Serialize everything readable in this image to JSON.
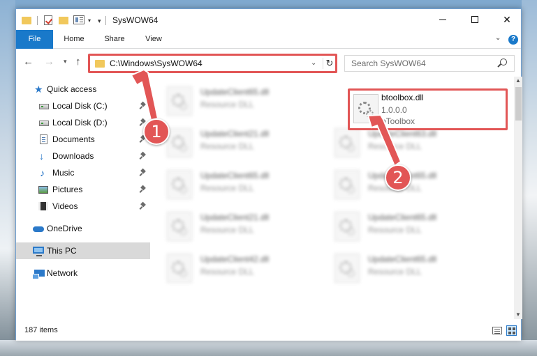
{
  "window": {
    "title": "SysWOW64",
    "minimize_icon": "minimize-icon",
    "maximize_icon": "maximize-icon",
    "close_label": "✕"
  },
  "ribbon": {
    "tabs": [
      "File",
      "Home",
      "Share",
      "View"
    ],
    "help_label": "?"
  },
  "navigation": {
    "address_path": "C:\\Windows\\SysWOW64",
    "search_placeholder": "Search SysWOW64"
  },
  "sidebar": {
    "items": [
      {
        "label": "Quick access",
        "icon": "star-icon"
      },
      {
        "label": "Local Disk (C:)",
        "icon": "drive-icon"
      },
      {
        "label": "Local Disk (D:)",
        "icon": "drive-icon"
      },
      {
        "label": "Documents",
        "icon": "documents-icon"
      },
      {
        "label": "Downloads",
        "icon": "download-icon"
      },
      {
        "label": "Music",
        "icon": "music-icon"
      },
      {
        "label": "Pictures",
        "icon": "pictures-icon"
      },
      {
        "label": "Videos",
        "icon": "videos-icon"
      },
      {
        "label": "OneDrive",
        "icon": "onedrive-icon"
      },
      {
        "label": "This PC",
        "icon": "pc-icon"
      },
      {
        "label": "Network",
        "icon": "network-icon"
      }
    ]
  },
  "files": {
    "left_column": [
      {
        "name": "UpdateClient65.dll",
        "type": "Resource DLL"
      },
      {
        "name": "UpdateClient21.dll",
        "type": "Resource DLL"
      },
      {
        "name": "UpdateClient65.dll",
        "type": "Resource DLL"
      },
      {
        "name": "UpdateClient21.dll",
        "type": "Resource DLL"
      },
      {
        "name": "UpdateClient42.dll",
        "type": "Resource DLL"
      }
    ],
    "highlighted": {
      "name": "btoolbox.dll",
      "version": "1.0.0.0",
      "description": "bToolbox"
    },
    "right_column": [
      {
        "name": "UpdateClient63.dll",
        "type": "Resource DLL"
      },
      {
        "name": "UpdateClient65.dll",
        "type": "Resource DLL"
      },
      {
        "name": "UpdateClient65.dll",
        "type": "Resource DLL"
      },
      {
        "name": "UpdateClient65.dll",
        "type": "Resource DLL"
      }
    ]
  },
  "status": {
    "item_count": "187 items"
  },
  "annotations": {
    "step1": "1",
    "step2": "2",
    "color": "#e25656"
  }
}
